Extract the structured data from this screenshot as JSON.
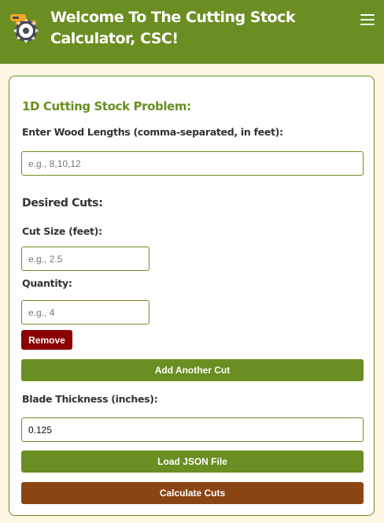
{
  "header": {
    "title": "Welcome To The Cutting Stock Calculator, CSC!",
    "logo_icon": "circular-saw-icon",
    "menu_icon": "hamburger-menu-icon"
  },
  "form": {
    "section_title": "1D Cutting Stock Problem:",
    "wood_lengths": {
      "label": "Enter Wood Lengths (comma-separated, in feet):",
      "placeholder": "e.g., 8,10,12",
      "value": ""
    },
    "desired_cuts_title": "Desired Cuts:",
    "cut_size": {
      "label": "Cut Size (feet):",
      "placeholder": "e.g., 2.5",
      "value": ""
    },
    "quantity": {
      "label": "Quantity:",
      "placeholder": "e.g., 4",
      "value": ""
    },
    "remove_label": "Remove",
    "add_cut_label": "Add Another Cut",
    "blade_thickness": {
      "label": "Blade Thickness (inches):",
      "value": "0.125"
    },
    "load_json_label": "Load JSON File",
    "calculate_label": "Calculate Cuts"
  },
  "colors": {
    "primary_green": "#6b8e23",
    "page_background": "#fdf7e3",
    "remove_red": "#8b0000",
    "calculate_brown": "#8b4513"
  }
}
